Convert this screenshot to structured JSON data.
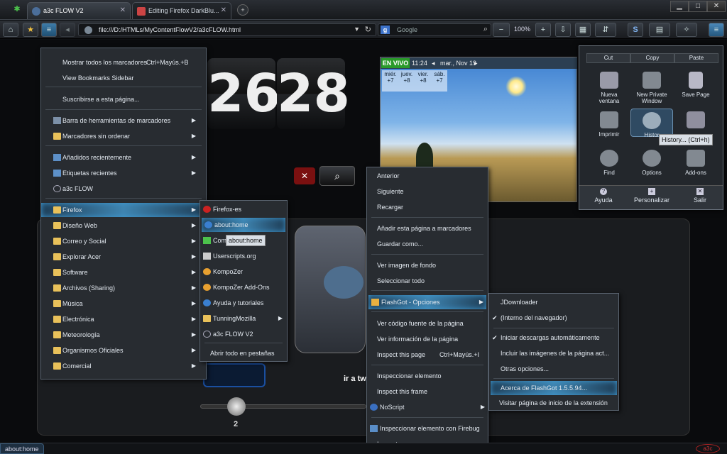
{
  "tabs": [
    {
      "title": "a3c FLOW V2",
      "active": true
    },
    {
      "title": "Editing Firefox DarkBlu...",
      "active": false
    }
  ],
  "window_controls": {
    "minimize": "▁",
    "maximize": "□",
    "close": "✕"
  },
  "navbar": {
    "url": "file:///D:/HTMLs/MyContentFlowV2/a3cFLOW.html",
    "search_placeholder": "Google",
    "zoom": "100%"
  },
  "clock": {
    "minutes": "26",
    "seconds": "28"
  },
  "weather": {
    "live_label": "EN VIVO",
    "time": "11:24",
    "date": "mar., Nov 19",
    "days": [
      {
        "name": "miér.",
        "temp": "+7"
      },
      {
        "name": "juev.",
        "temp": "+8"
      },
      {
        "name": "vier.",
        "temp": "+8"
      },
      {
        "name": "sáb.",
        "temp": "+7"
      }
    ]
  },
  "page": {
    "tweet_label": "ir a tw",
    "slider_value": "2"
  },
  "bookmarks_menu": {
    "items": [
      {
        "label": "Mostrar todos los marcadores",
        "accel": "Ctrl+Mayús.+B"
      },
      {
        "label": "View Bookmarks Sidebar"
      },
      {
        "label": "Suscribirse a esta página..."
      },
      {
        "label": "Barra de herramientas de marcadores",
        "submenu": true
      },
      {
        "label": "Marcadores sin ordenar",
        "submenu": true
      },
      {
        "label": "Añadidos recientemente",
        "submenu": true
      },
      {
        "label": "Etiquetas recientes",
        "submenu": true
      },
      {
        "label": "a3c FLOW"
      },
      {
        "label": "Firefox",
        "submenu": true,
        "highlight": true
      },
      {
        "label": "Diseño Web",
        "submenu": true
      },
      {
        "label": "Correo y Social",
        "submenu": true
      },
      {
        "label": "Explorar Acer",
        "submenu": true
      },
      {
        "label": "Software",
        "submenu": true
      },
      {
        "label": "Archivos (Sharing)",
        "submenu": true
      },
      {
        "label": "Música",
        "submenu": true
      },
      {
        "label": "Electrónica",
        "submenu": true
      },
      {
        "label": "Meteorología",
        "submenu": true
      },
      {
        "label": "Organismos Oficiales",
        "submenu": true
      },
      {
        "label": "Comercial",
        "submenu": true
      }
    ]
  },
  "firefox_submenu": {
    "items": [
      {
        "label": "Firefox-es"
      },
      {
        "label": "about:home",
        "highlight": true
      },
      {
        "label": "Com"
      },
      {
        "label": "Userscripts.org"
      },
      {
        "label": "KompoZer"
      },
      {
        "label": "KompoZer Add-Ons"
      },
      {
        "label": "Ayuda y tutoriales"
      },
      {
        "label": "TunningMozilla",
        "submenu": true
      },
      {
        "label": "a3c FLOW V2"
      },
      {
        "label": "Abrir todo en pestañas"
      }
    ],
    "tooltip": "about:home"
  },
  "context_menu": {
    "items": [
      {
        "label": "Anterior"
      },
      {
        "label": "Siguiente"
      },
      {
        "label": "Recargar"
      },
      {
        "label": "Añadir esta página a marcadores"
      },
      {
        "label": "Guardar como..."
      },
      {
        "label": "Ver imagen de fondo"
      },
      {
        "label": "Seleccionar todo"
      },
      {
        "label": "FlashGot - Opciones",
        "submenu": true,
        "highlight": true
      },
      {
        "label": "Ver código fuente de la página"
      },
      {
        "label": "Ver información de la página"
      },
      {
        "label": "Inspect this page",
        "accel": "Ctrl+Mayús.+I"
      },
      {
        "label": "Inspeccionar elemento"
      },
      {
        "label": "Inspect this frame"
      },
      {
        "label": "NoScript",
        "submenu": true
      },
      {
        "label": "Inspeccionar elemento con Firebug"
      },
      {
        "label": "Inspect"
      }
    ]
  },
  "flashgot_submenu": {
    "items": [
      {
        "label": "JDownloader"
      },
      {
        "label": "(Interno del navegador)",
        "checked": true
      },
      {
        "label": "Iniciar descargas automáticamente",
        "checked": true
      },
      {
        "label": "Incluir las imágenes de la página act..."
      },
      {
        "label": "Otras opciones..."
      },
      {
        "label": "Acerca de FlashGot 1.5.5.94...",
        "highlight": true
      },
      {
        "label": "Visitar página de inicio de la extensión"
      }
    ]
  },
  "app_menu": {
    "edit": {
      "cut": "Cut",
      "copy": "Copy",
      "paste": "Paste"
    },
    "grid": [
      {
        "label": "Nueva\nventana",
        "icon": "window-icon"
      },
      {
        "label": "New Private\nWindow",
        "icon": "mask-icon"
      },
      {
        "label": "Save Page",
        "icon": "page-icon"
      },
      {
        "label": "Imprimir",
        "icon": "printer-icon"
      },
      {
        "label": "Histor",
        "icon": "clock-icon"
      },
      {
        "label": "",
        "icon": "move-icon"
      },
      {
        "label": "Find",
        "icon": "magnifier-icon"
      },
      {
        "label": "Options",
        "icon": "gear-icon"
      },
      {
        "label": "Add-ons",
        "icon": "puzzle-icon"
      }
    ],
    "tooltip": "History... (Ctrl+h)",
    "footer": {
      "help": "Ayuda",
      "customize": "Personalizar",
      "exit": "Salir"
    }
  },
  "status": {
    "text": "about:home"
  }
}
